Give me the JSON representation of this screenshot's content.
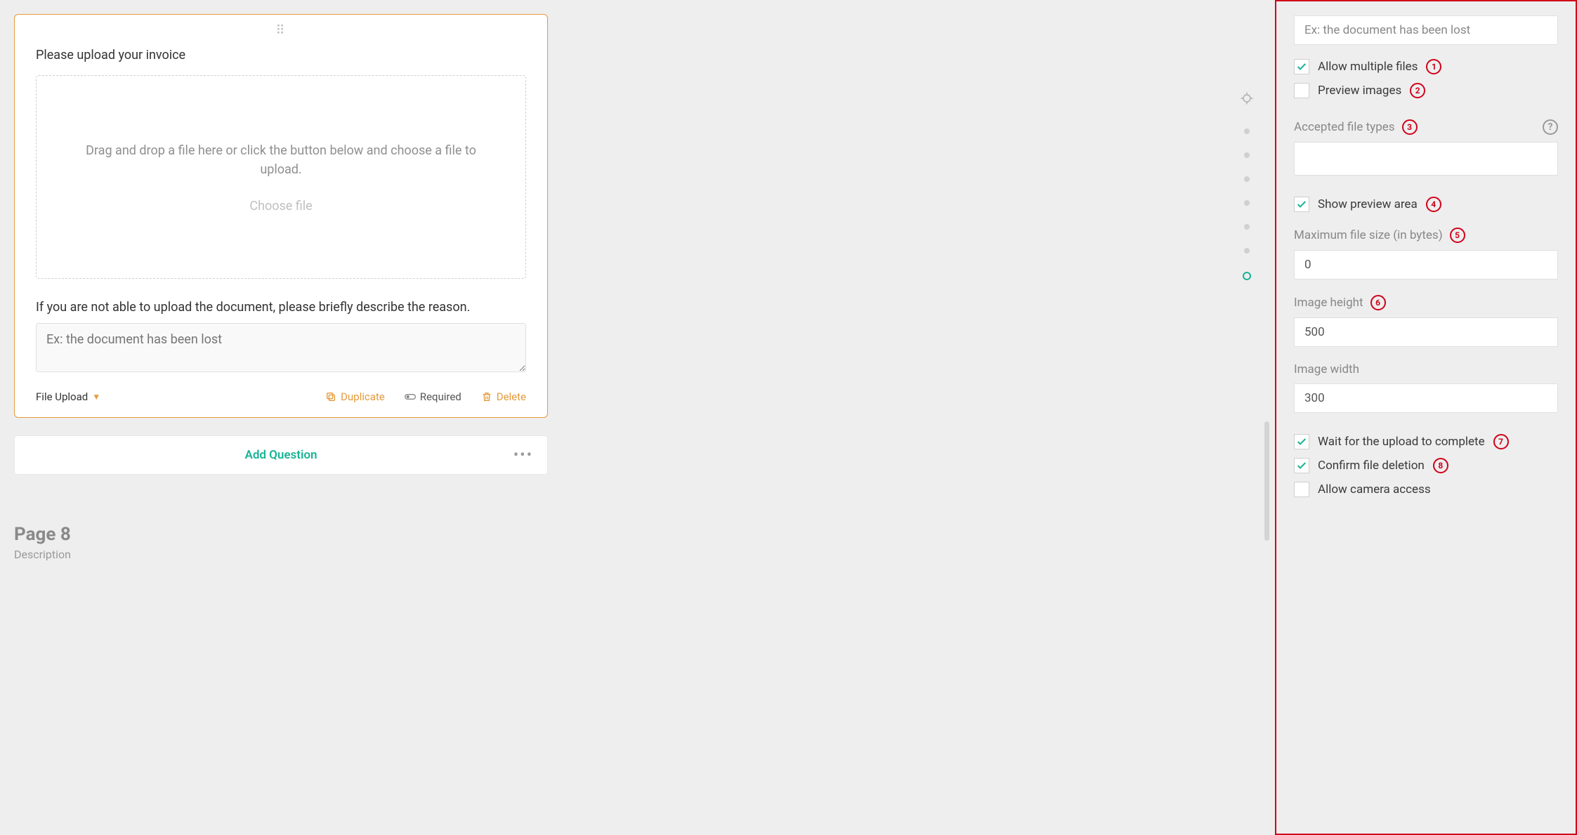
{
  "left": {
    "question_title": "Please upload your invoice",
    "dropzone_line1": "Drag and drop a file here or click the button below and choose a file to upload.",
    "choose_file": "Choose file",
    "sub_question": "If you are not able to upload the document, please briefly describe the reason.",
    "textarea_placeholder": "Ex: the document has been lost",
    "type_label": "File Upload",
    "duplicate": "Duplicate",
    "required": "Required",
    "delete": "Delete",
    "add_question": "Add Question",
    "page_title": "Page 8",
    "page_desc": "Description"
  },
  "right": {
    "top_input": "Ex: the document has been lost",
    "allow_multiple": {
      "label": "Allow multiple files",
      "checked": true,
      "badge": "1"
    },
    "preview_images": {
      "label": "Preview images",
      "checked": false,
      "badge": "2"
    },
    "accepted_types": {
      "label": "Accepted file types",
      "badge": "3",
      "value": ""
    },
    "show_preview": {
      "label": "Show preview area",
      "checked": true,
      "badge": "4"
    },
    "max_size": {
      "label": "Maximum file size (in bytes)",
      "badge": "5",
      "value": "0"
    },
    "image_height": {
      "label": "Image height",
      "badge": "6",
      "value": "500"
    },
    "image_width": {
      "label": "Image width",
      "value": "300"
    },
    "wait_upload": {
      "label": "Wait for the upload to complete",
      "checked": true,
      "badge": "7"
    },
    "confirm_delete": {
      "label": "Confirm file deletion",
      "checked": true,
      "badge": "8"
    },
    "camera_access": {
      "label": "Allow camera access",
      "checked": false
    }
  }
}
